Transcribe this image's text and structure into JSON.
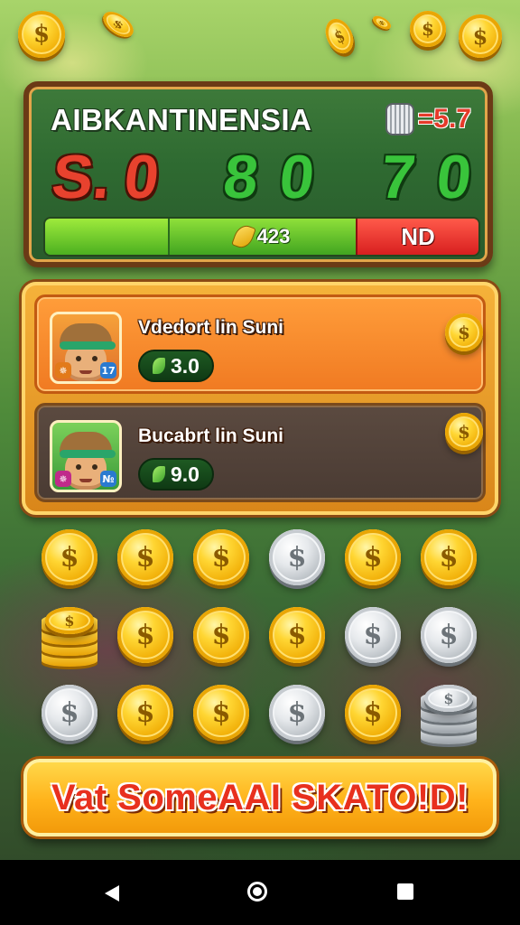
{
  "scoreboard": {
    "title": "AIBKANTINENSIA",
    "ratio": "=5.7",
    "scores": [
      "S.",
      "0",
      "8",
      "0",
      "7",
      "0"
    ],
    "bar_value": "423",
    "bar_right": "ND"
  },
  "players": [
    {
      "name": "Vdedort lin Suni",
      "score": "3.0",
      "badge_left": "✵",
      "badge_right": "17"
    },
    {
      "name": "Bucabrt lin Suni",
      "score": "9.0",
      "badge_left": "✵",
      "badge_right": "№"
    }
  ],
  "coin_grid": [
    [
      "gold",
      "gold",
      "gold",
      "silver",
      "gold",
      "gold"
    ],
    [
      "gold-stack",
      "gold",
      "gold",
      "gold",
      "silver",
      "silver"
    ],
    [
      "silver",
      "gold",
      "gold",
      "silver",
      "gold",
      "silver-stack"
    ]
  ],
  "action_button": {
    "label": "Vat SomeAAI SKATO!D!"
  },
  "colors": {
    "accent_red": "#e8422e",
    "accent_green": "#39c43b",
    "gold": "#ffd633",
    "board_green": "#2e6a31"
  },
  "icons": {
    "coin_symbol": "$",
    "nav_back": "back-icon",
    "nav_home": "home-icon",
    "nav_recent": "recent-apps-icon"
  }
}
